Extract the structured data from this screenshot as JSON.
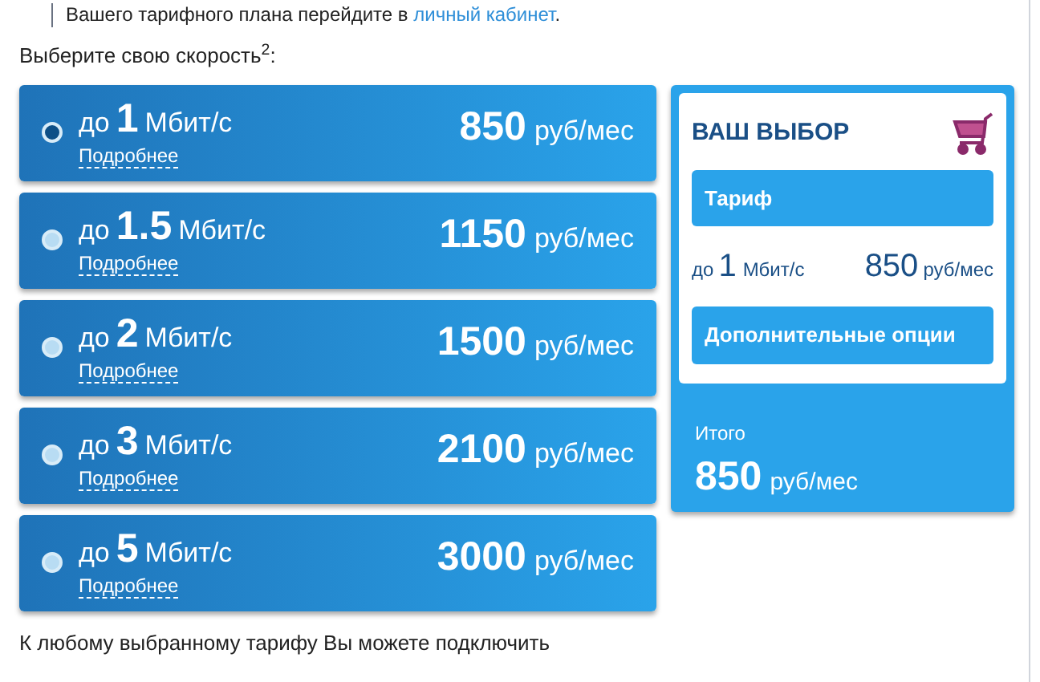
{
  "top_note": {
    "text": "Вашего тарифного плана перейдите в ",
    "link": "личный кабинет",
    "end": "."
  },
  "prompt": "Выберите свою скорость$^{2}$:",
  "plans": [
    {
      "prefix": "до",
      "speed": "1",
      "unit": "Мбит/с",
      "details": "Подробнее",
      "price": "850",
      "price_unit": "руб/мес",
      "selected": true
    },
    {
      "prefix": "до",
      "speed": "1.5",
      "unit": "Мбит/с",
      "details": "Подробнее",
      "price": "1150",
      "price_unit": "руб/мес",
      "selected": false
    },
    {
      "prefix": "до",
      "speed": "2",
      "unit": "Мбит/с",
      "details": "Подробнее",
      "price": "1500",
      "price_unit": "руб/мес",
      "selected": false
    },
    {
      "prefix": "до",
      "speed": "3",
      "unit": "Мбит/с",
      "details": "Подробнее",
      "price": "2100",
      "price_unit": "руб/мес",
      "selected": false
    },
    {
      "prefix": "до",
      "speed": "5",
      "unit": "Мбит/с",
      "details": "Подробнее",
      "price": "3000",
      "price_unit": "руб/мес",
      "selected": false
    }
  ],
  "choice": {
    "title": "ВАШ ВЫБОР",
    "tariff_header": "Тариф",
    "prefix": "до",
    "speed": "1",
    "unit": "Мбит/с",
    "price": "850",
    "price_unit": "руб/мес",
    "options_header": "Дополнительные опции",
    "total_label": "Итого",
    "total": "850",
    "total_unit": "руб/мес"
  },
  "bottom_note": "К любому выбранному тарифу Вы можете подключить"
}
